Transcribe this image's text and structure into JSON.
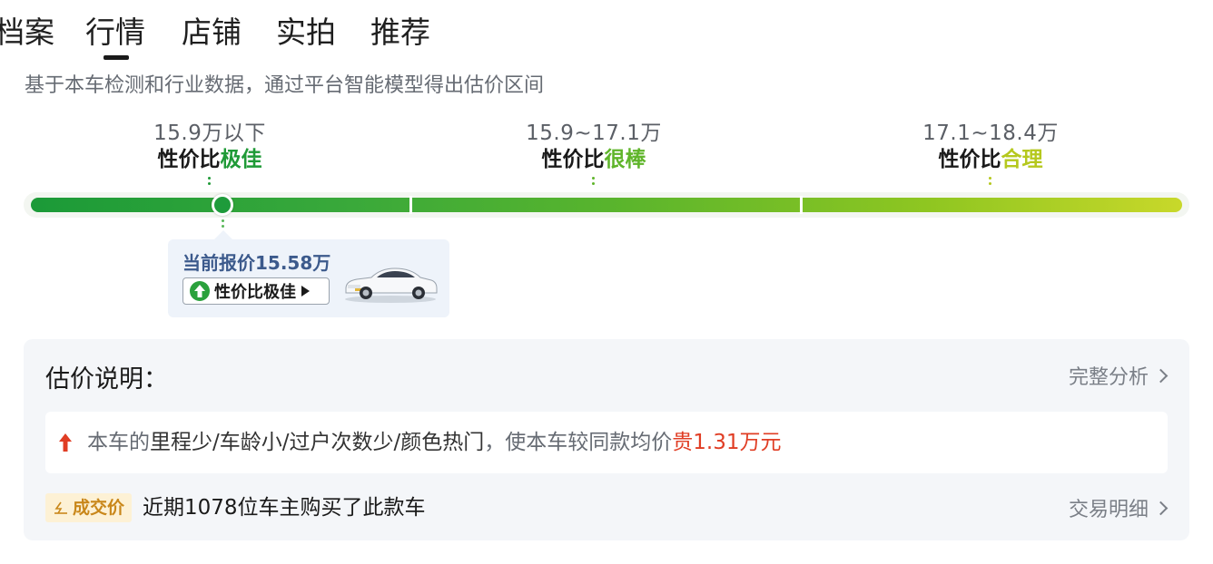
{
  "tabs": [
    "档案",
    "行情",
    "店铺",
    "实拍",
    "推荐"
  ],
  "active_tab_index": 1,
  "subtitle": "基于本车检测和行业数据，通过平台智能模型得出估价区间",
  "ranges": [
    {
      "price": "15.9万以下",
      "prefix": "性价比",
      "level": "极佳",
      "color": "#1f9a37"
    },
    {
      "price": "15.9~17.1万",
      "prefix": "性价比",
      "level": "很棒",
      "color": "#5fb52a"
    },
    {
      "price": "17.1~18.4万",
      "prefix": "性价比",
      "level": "合理",
      "color": "#b5c81e"
    }
  ],
  "current_quote": {
    "price_label": "当前报价15.58万",
    "value_wan": 15.58,
    "badge": "性价比极佳"
  },
  "explanation": {
    "title": "估价说明：",
    "full_analysis_label": "完整分析",
    "reason_prefix": "本车的",
    "reason_factors": "里程少/车龄小/过户次数少/颜色热门",
    "reason_middle": "，使本车较同款均价",
    "reason_diff": "贵1.31万元",
    "deal_tag": "成交价",
    "deal_text": "近期1078位车主购买了此款车",
    "deal_link_label": "交易明细"
  },
  "colors": {
    "accent_green": "#1e9b3b",
    "price_up_red": "#e03d24",
    "deal_tag_bg": "#fdf1d5"
  }
}
